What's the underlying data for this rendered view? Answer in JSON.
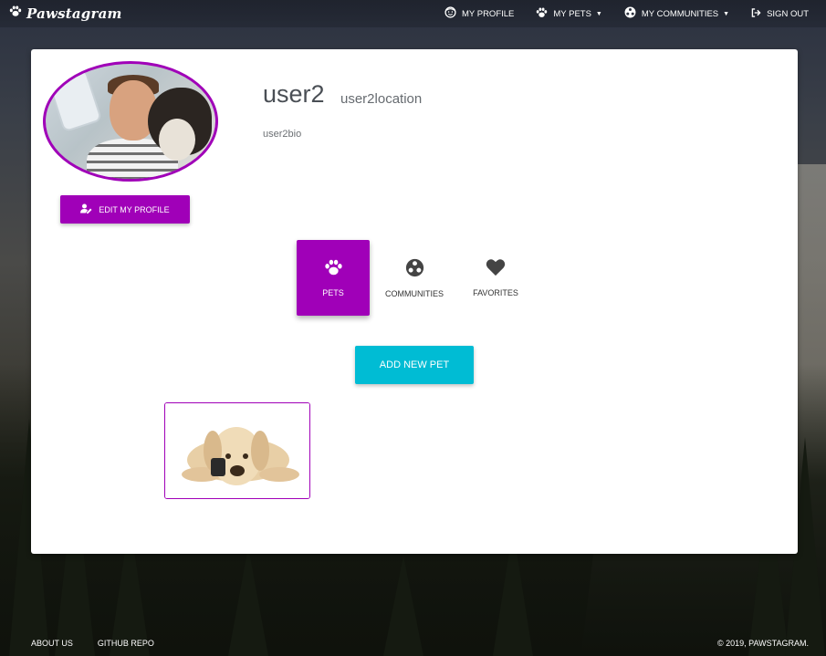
{
  "nav": {
    "brand": "Pawstagram",
    "my_profile": "MY PROFILE",
    "my_pets": "MY PETS",
    "my_communities": "MY COMMUNITIES",
    "sign_out": "SIGN OUT"
  },
  "profile": {
    "username": "user2",
    "location": "user2location",
    "bio": "user2bio",
    "edit_label": "EDIT MY PROFILE"
  },
  "tabs": [
    {
      "label": "PETS",
      "icon": "paw-icon",
      "active": true
    },
    {
      "label": "COMMUNITIES",
      "icon": "communities-icon",
      "active": false
    },
    {
      "label": "FAVORITES",
      "icon": "heart-icon",
      "active": false
    }
  ],
  "add_pet_label": "ADD NEW PET",
  "colors": {
    "accent": "#a000b8",
    "add_button": "#00bcd4"
  },
  "footer": {
    "about": "ABOUT US",
    "github": "GITHUB REPO",
    "copyright": "© 2019, PAWSTAGRAM."
  }
}
